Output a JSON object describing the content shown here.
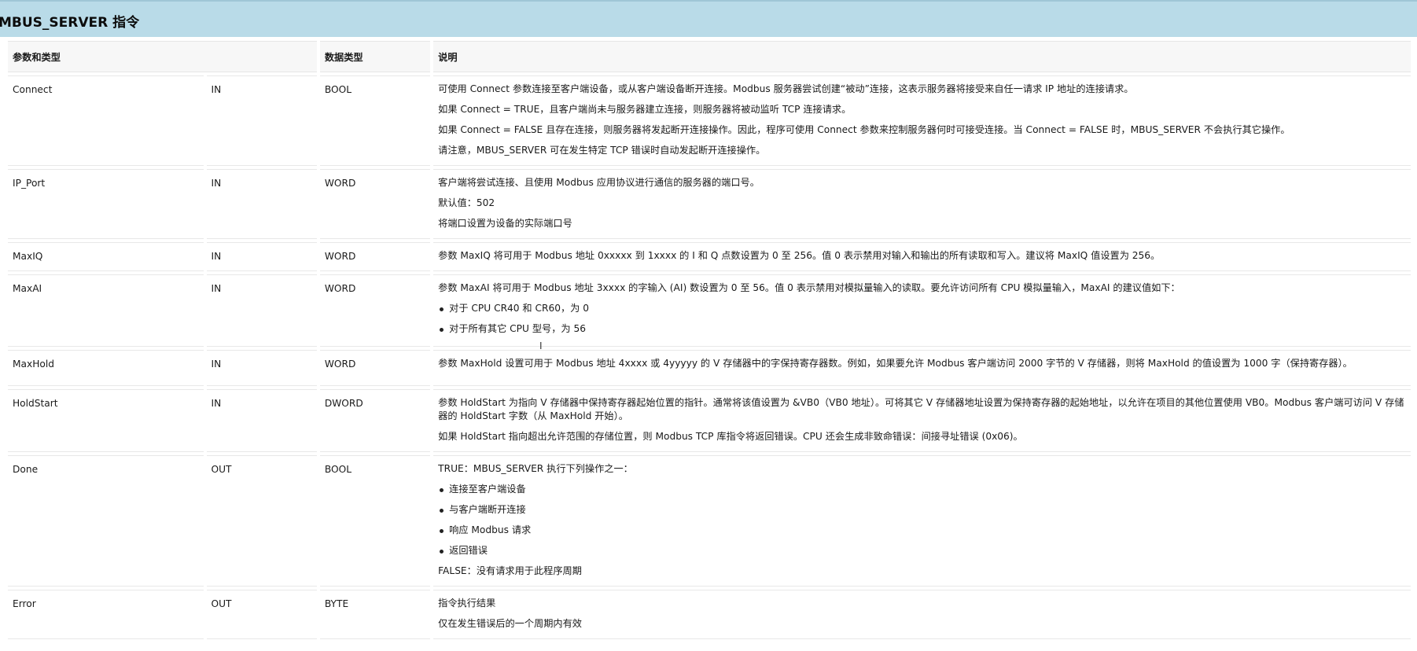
{
  "page": {
    "title": "MBUS_SERVER 指令"
  },
  "table": {
    "headers": {
      "param": "参数和类型",
      "datatype": "数据类型",
      "desc": "说明"
    },
    "rows": [
      {
        "name": "Connect",
        "direction": "IN",
        "type": "BOOL",
        "paragraphs": [
          "可使用 Connect 参数连接至客户端设备，或从客户端设备断开连接。Modbus 服务器尝试创建“被动”连接，这表示服务器将接受来自任一请求 IP 地址的连接请求。",
          "如果 Connect = TRUE，且客户端尚未与服务器建立连接，则服务器将被动监听 TCP 连接请求。",
          "如果 Connect = FALSE 且存在连接，则服务器将发起断开连接操作。因此，程序可使用 Connect 参数来控制服务器何时可接受连接。当 Connect = FALSE 时，MBUS_SERVER 不会执行其它操作。",
          "请注意，MBUS_SERVER 可在发生特定 TCP 错误时自动发起断开连接操作。"
        ]
      },
      {
        "name": "IP_Port",
        "direction": "IN",
        "type": "WORD",
        "paragraphs": [
          "客户端将尝试连接、且使用 Modbus 应用协议进行通信的服务器的端口号。",
          "默认值：502",
          "将端口设置为设备的实际端口号"
        ]
      },
      {
        "name": "MaxIQ",
        "direction": "IN",
        "type": "WORD",
        "paragraphs": [
          "参数 MaxIQ 将可用于 Modbus 地址 0xxxxx 到 1xxxx 的 I 和 Q 点数设置为 0 至 256。值 0 表示禁用对输入和输出的所有读取和写入。建议将 MaxIQ 值设置为 256。"
        ]
      },
      {
        "name": "MaxAI",
        "direction": "IN",
        "type": "WORD",
        "paragraphs": [
          "参数 MaxAI 将可用于 Modbus 地址 3xxxx 的字输入 (AI) 数设置为 0 至 56。值 0 表示禁用对模拟量输入的读取。要允许访问所有 CPU 模拟量输入，MaxAI 的建议值如下："
        ],
        "bullets": [
          "对于 CPU CR40 和 CR60，为 0",
          "对于所有其它 CPU 型号，为 56"
        ]
      },
      {
        "name": "MaxHold",
        "direction": "IN",
        "type": "WORD",
        "paragraphs": [
          "参数 MaxHold 设置可用于 Modbus 地址 4xxxx 或 4yyyyy 的 V 存储器中的字保持寄存器数。例如，如果要允许 Modbus 客户端访问 2000 字节的 V 存储器，则将 MaxHold 的值设置为 1000 字（保持寄存器）。"
        ]
      },
      {
        "name": "HoldStart",
        "direction": "IN",
        "type": "DWORD",
        "paragraphs": [
          "参数 HoldStart 为指向 V 存储器中保持寄存器起始位置的指针。通常将该值设置为 &VB0（VB0 地址）。可将其它 V 存储器地址设置为保持寄存器的起始地址，以允许在项目的其他位置使用 VB0。Modbus 客户端可访问 V 存储器的 HoldStart 字数（从 MaxHold 开始）。",
          "如果 HoldStart 指向超出允许范围的存储位置，则 Modbus TCP 库指令将返回错误。CPU 还会生成非致命错误：间接寻址错误 (0x06)。"
        ]
      },
      {
        "name": "Done",
        "direction": "OUT",
        "type": "BOOL",
        "paragraphs": [
          "TRUE：MBUS_SERVER 执行下列操作之一："
        ],
        "bullets": [
          "连接至客户端设备",
          "与客户端断开连接",
          "响应 Modbus 请求",
          "返回错误"
        ],
        "after": [
          "FALSE：没有请求用于此程序周期"
        ]
      },
      {
        "name": "Error",
        "direction": "OUT",
        "type": "BYTE",
        "paragraphs": [
          "指令执行结果",
          "仅在发生错误后的一个周期内有效"
        ]
      }
    ]
  }
}
